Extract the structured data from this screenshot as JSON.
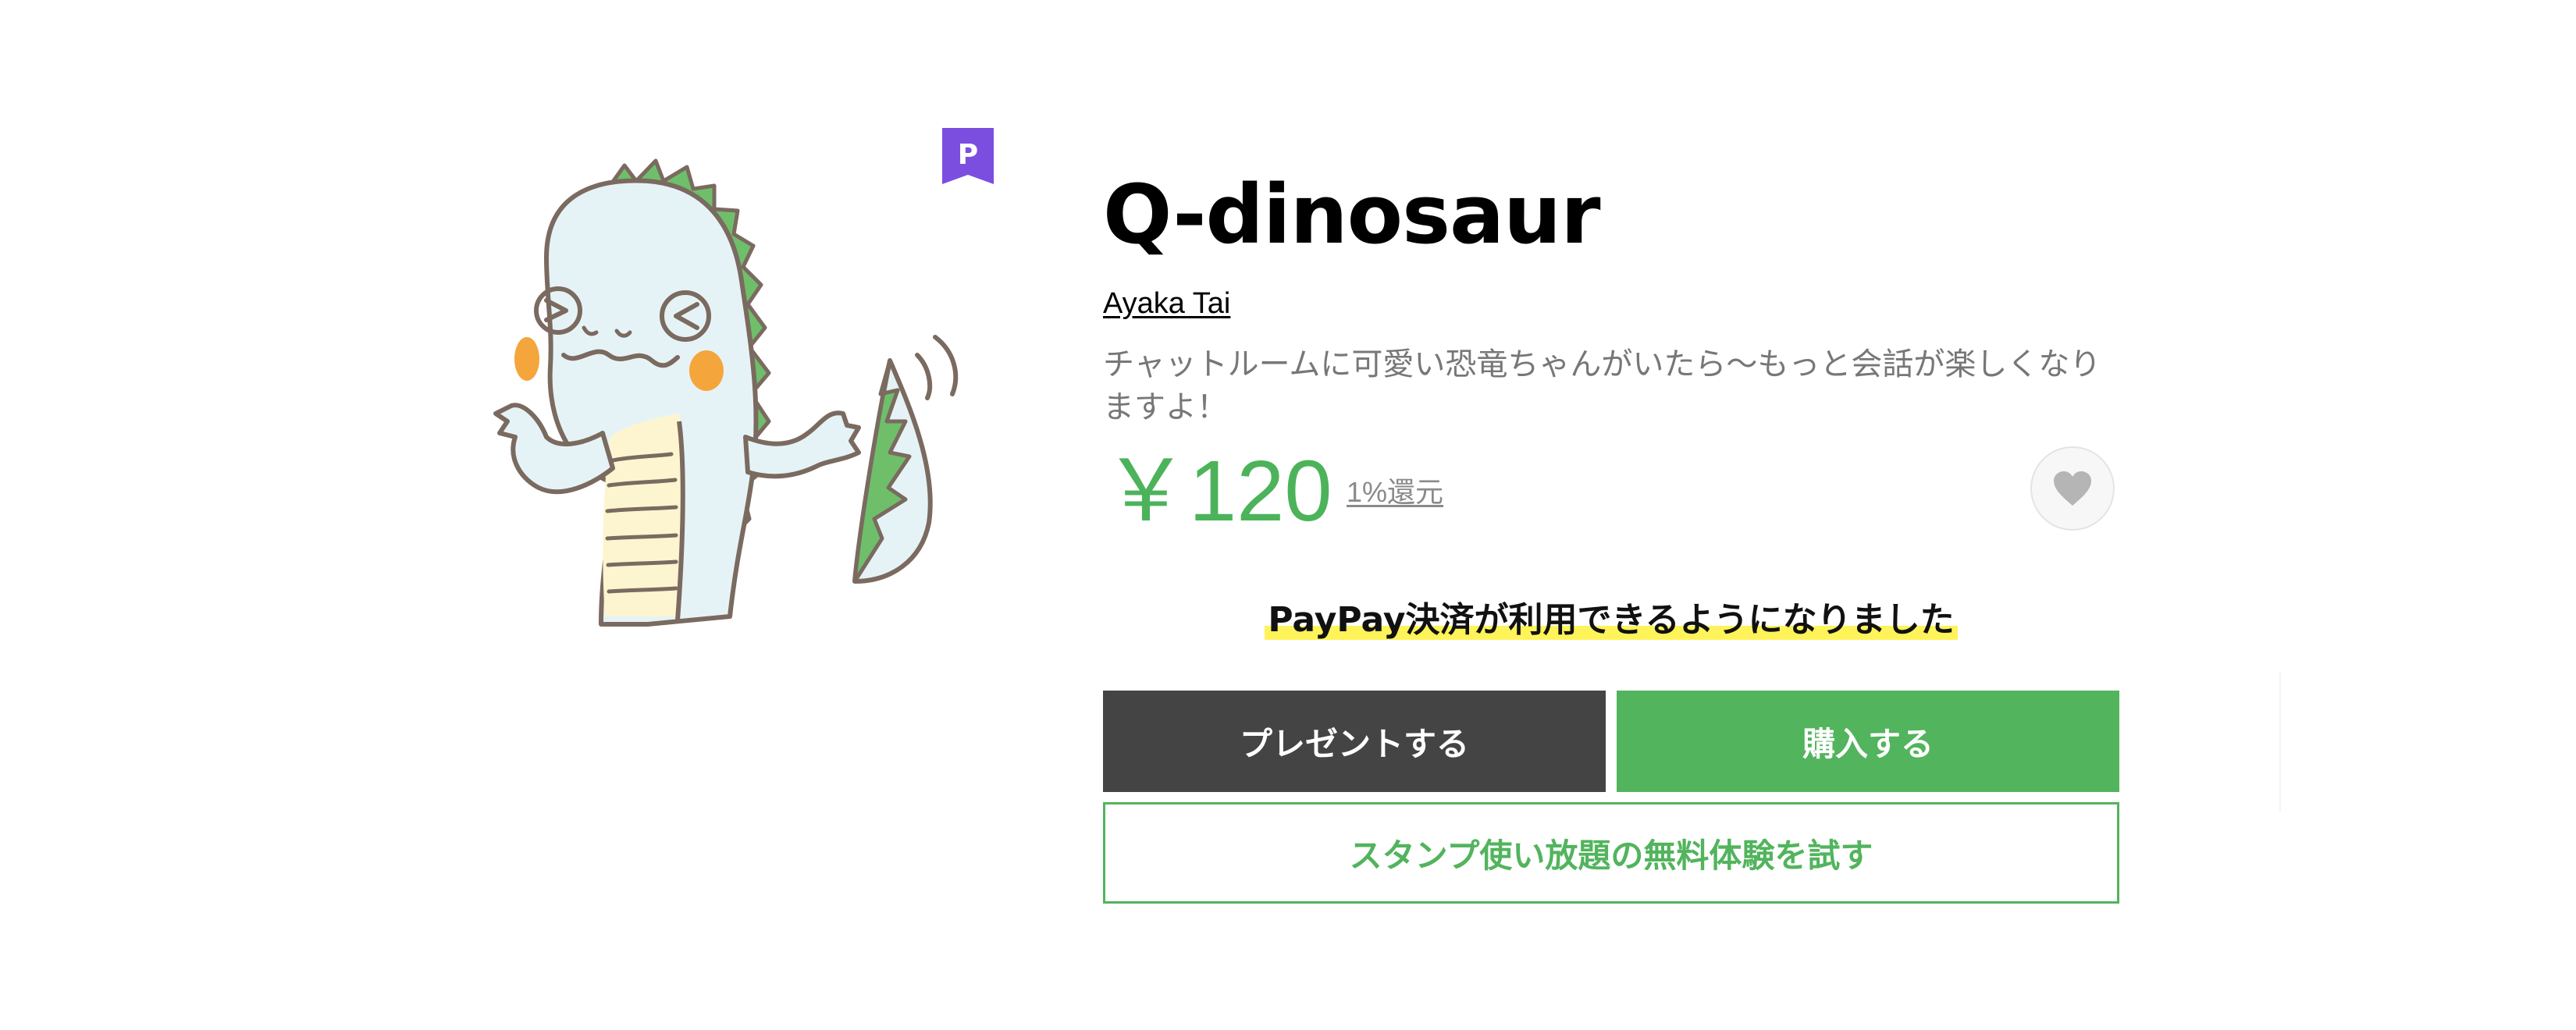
{
  "sticker": {
    "title": "Q-dinosaur",
    "author": "Ayaka Tai",
    "description": "チャットルームに可愛い恐竜ちゃんがいたら〜もっと会話が楽しくなりますよ！",
    "price": "￥120",
    "rebate": "1%還元",
    "premium_badge_label": "P",
    "premium_icon": "premium-badge-icon",
    "favorite_icon": "heart-icon"
  },
  "notice": {
    "text": "PayPay決済が利用できるようになりました"
  },
  "actions": {
    "gift_label": "プレゼントする",
    "buy_label": "購入する",
    "trial_label": "スタンプ使い放題の無料体験を試す"
  },
  "colors": {
    "accent_green": "#52b45d",
    "price_green": "#4cb35a",
    "gift_dark": "#444444",
    "premium_purple": "#7b4ee0",
    "highlight_yellow": "#fff35a",
    "description_gray": "#777777"
  }
}
